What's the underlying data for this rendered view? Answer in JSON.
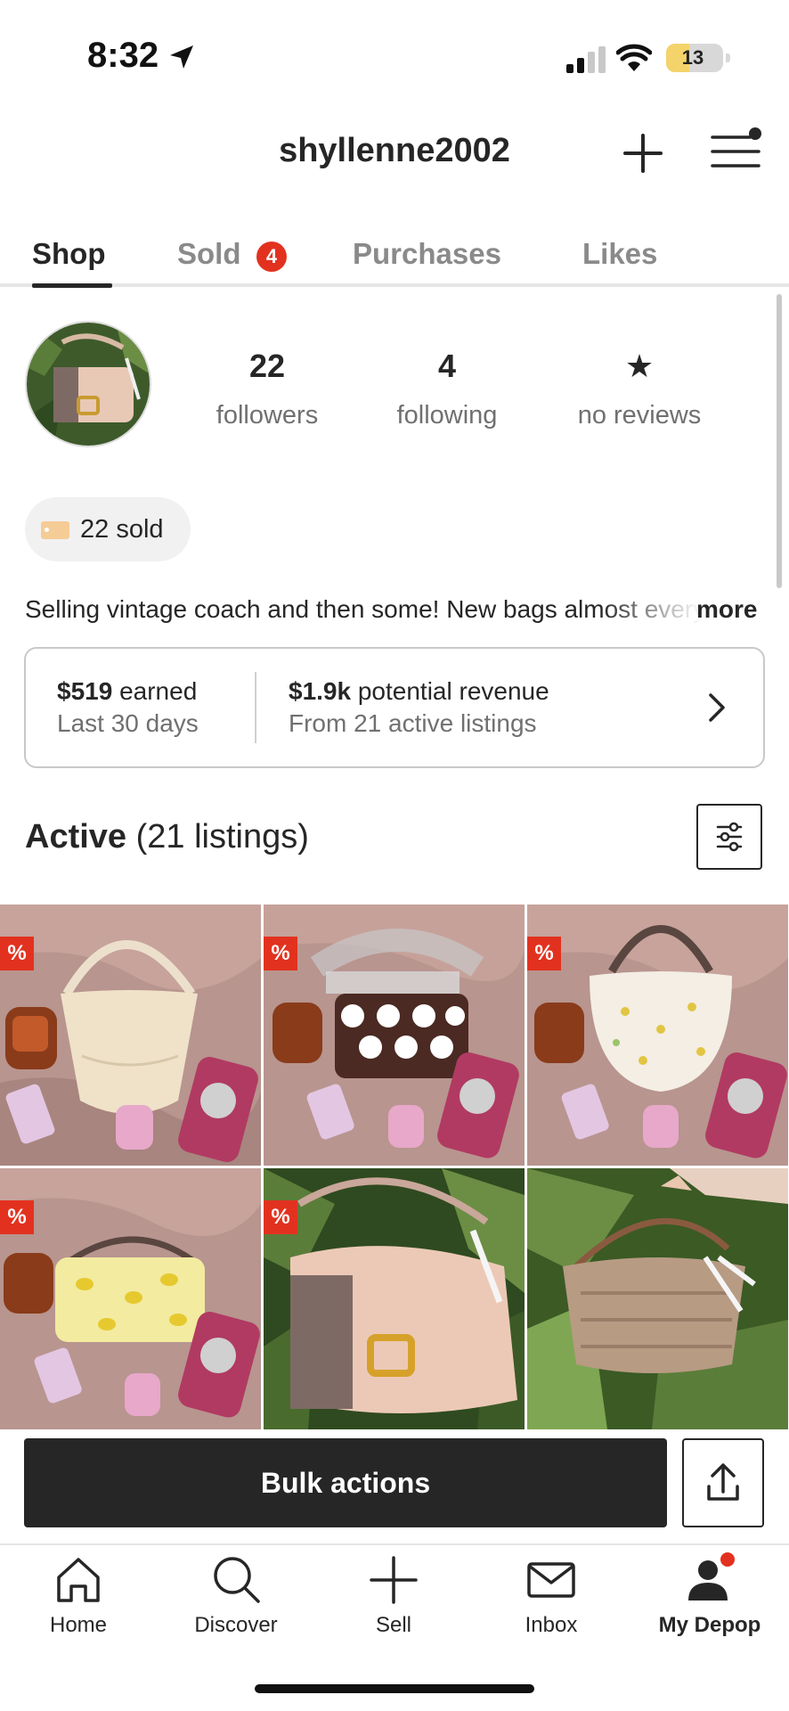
{
  "status_bar": {
    "time": "8:32",
    "battery": "13",
    "icons": [
      "location-arrow-icon",
      "signal-icon",
      "wifi-icon",
      "battery-icon"
    ]
  },
  "header": {
    "username": "shyllenne2002",
    "icons": [
      "plus-icon",
      "menu-icon"
    ]
  },
  "tabs": [
    {
      "label": "Shop",
      "active": true
    },
    {
      "label": "Sold",
      "badge": "4"
    },
    {
      "label": "Purchases"
    },
    {
      "label": "Likes"
    }
  ],
  "profile": {
    "stats": [
      {
        "value": "22",
        "label": "followers"
      },
      {
        "value": "4",
        "label": "following"
      },
      {
        "value": "★",
        "label": "no reviews"
      }
    ],
    "sold_pill": "22 sold",
    "bio": "Selling vintage coach and then some! New bags almost every week",
    "more_label": "more"
  },
  "earnings": {
    "earned_amount": "$519",
    "earned_word": "earned",
    "earned_period": "Last 30 days",
    "potential_amount": "$1.9k",
    "potential_word": "potential revenue",
    "potential_source": "From 21 active listings"
  },
  "active": {
    "title": "Active",
    "count": "(21 listings)"
  },
  "listings": [
    {
      "discount_badge": "%",
      "item": "cream croc shoulder bag"
    },
    {
      "discount_badge": "%",
      "item": "polka dot brown bag"
    },
    {
      "discount_badge": "%",
      "item": "white floral crescent bag"
    },
    {
      "discount_badge": "%",
      "item": "yellow lemon print pouch"
    },
    {
      "discount_badge": "%",
      "item": "pink leather flap bag"
    },
    {
      "discount_badge": "",
      "item": "signature canvas bag"
    }
  ],
  "actions": {
    "bulk_label": "Bulk actions"
  },
  "bottom_nav": [
    {
      "label": "Home",
      "icon": "home-icon"
    },
    {
      "label": "Discover",
      "icon": "search-icon"
    },
    {
      "label": "Sell",
      "icon": "plus-icon"
    },
    {
      "label": "Inbox",
      "icon": "mail-icon"
    },
    {
      "label": "My Depop",
      "icon": "profile-icon",
      "active": true
    }
  ],
  "colors": {
    "accent_red": "#e2321f",
    "dark": "#262626",
    "muted": "#707070"
  }
}
